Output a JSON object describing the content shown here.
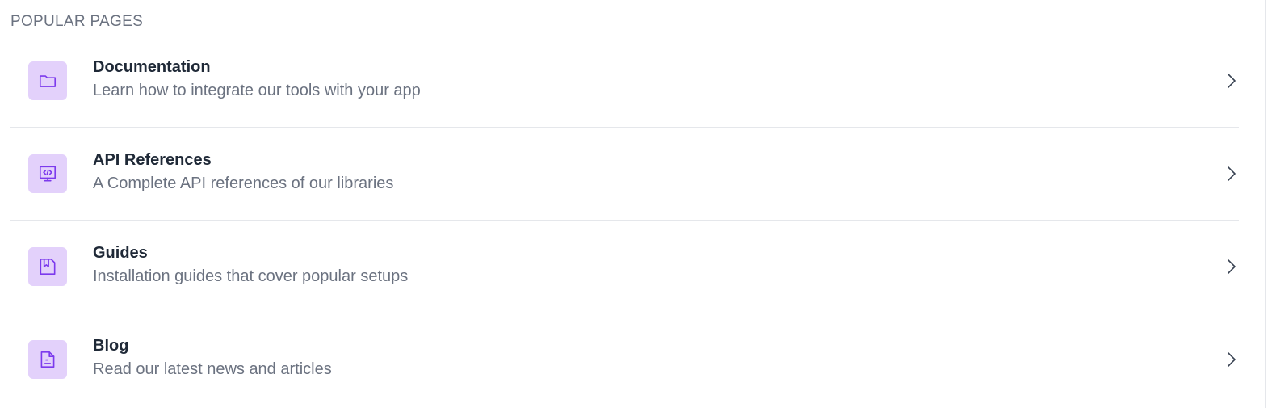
{
  "section": {
    "title": "POPULAR PAGES"
  },
  "colors": {
    "icon_background": "#e3d1fb",
    "icon_stroke": "#7c3aed",
    "title_text": "#1f2937",
    "muted_text": "#6b7280",
    "divider": "#e5e7eb"
  },
  "items": [
    {
      "icon": "folder-icon",
      "title": "Documentation",
      "description": "Learn how to integrate our tools with your app"
    },
    {
      "icon": "code-monitor-icon",
      "title": "API References",
      "description": "A Complete API references of our libraries"
    },
    {
      "icon": "bookmark-page-icon",
      "title": "Guides",
      "description": "Installation guides that cover popular setups"
    },
    {
      "icon": "document-icon",
      "title": "Blog",
      "description": "Read our latest news and articles"
    }
  ]
}
